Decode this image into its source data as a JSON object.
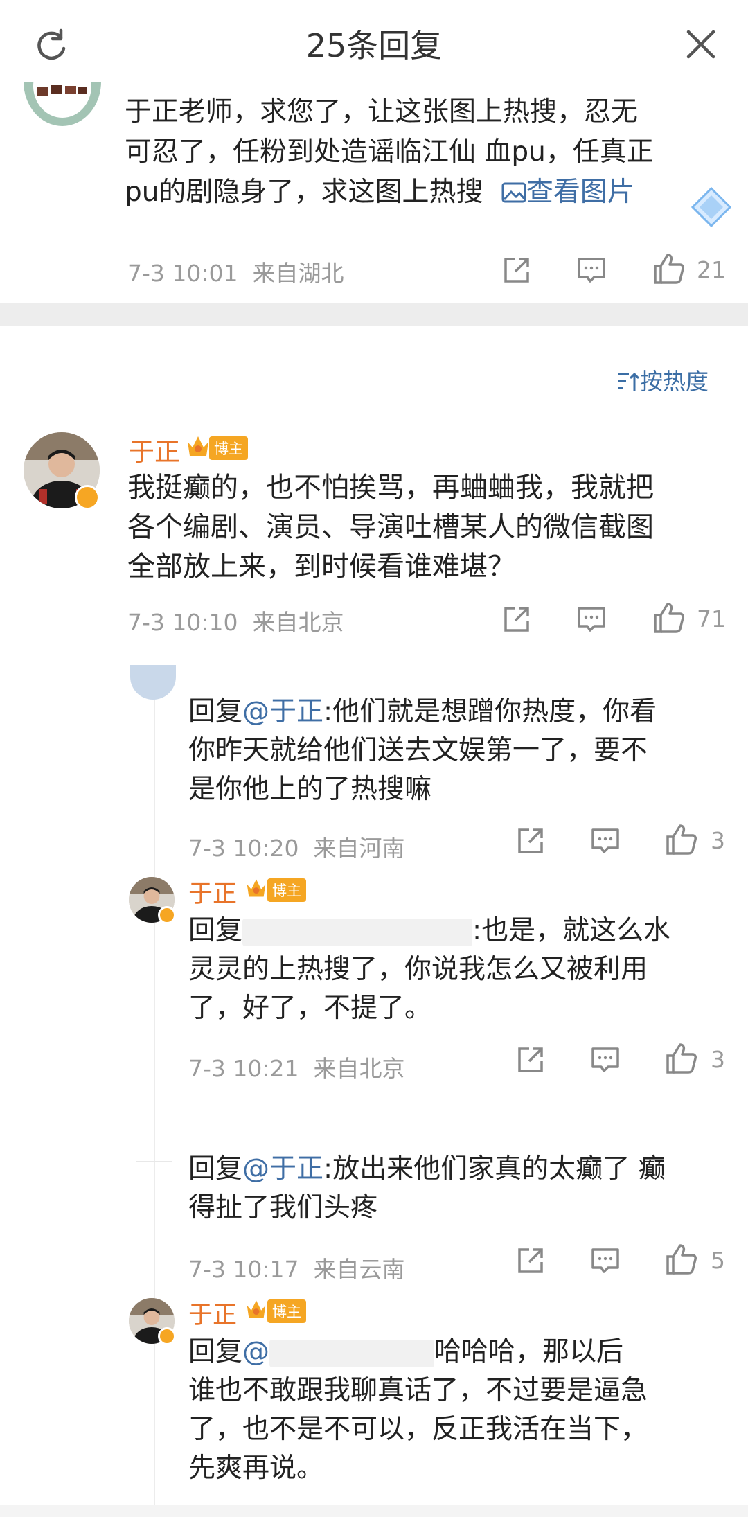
{
  "header": {
    "title": "25条回复"
  },
  "top_comment": {
    "lines": [
      "于正老师，求您了，让这张图上热搜，忍无",
      "可忍了，任粉到处造谣临江仙 血pu，任真正",
      "pu的剧隐身了，求这图上热搜"
    ],
    "view_image": "查看图片",
    "time": "7-3 10:01",
    "location": "来自湖北",
    "likes": "21"
  },
  "sort": {
    "label": "按热度"
  },
  "main_comment": {
    "author": "于正",
    "badge": "博主",
    "lines": [
      "我挺癫的，也不怕挨骂，再蛐蛐我，我就把",
      "各个编剧、演员、导演吐槽某人的微信截图",
      "全部放上来，到时候看谁难堪？"
    ],
    "time": "7-3 10:10",
    "location": "来自北京",
    "likes": "71"
  },
  "replies": [
    {
      "prefix": "回复",
      "mention": "@于正",
      "lines": [
        ":他们就是想蹭你热度，你看",
        "你昨天就给他们送去文娱第一了，要不",
        "是你他上的了热搜嘛"
      ],
      "time": "7-3 10:20",
      "location": "来自河南",
      "likes": "3"
    },
    {
      "author": "于正",
      "badge": "博主",
      "prefix": "回复",
      "lines": [
        ":也是，就这么水",
        "灵灵的上热搜了，你说我怎么又被利用",
        "了，好了，不提了。"
      ],
      "time": "7-3 10:21",
      "location": "来自北京",
      "likes": "3"
    },
    {
      "prefix": "回复",
      "mention": "@于正",
      "lines": [
        ":放出来他们家真的太癫了 癫",
        "得扯了我们头疼"
      ],
      "time": "7-3 10:17",
      "location": "来自云南",
      "likes": "5"
    },
    {
      "author": "于正",
      "badge": "博主",
      "prefix": "回复",
      "mention_partial": "@",
      "lines": [
        "哈哈哈，那以后",
        "谁也不敢跟我聊真话了，不过要是逼急",
        "了，也不是不可以，反正我活在当下，",
        "先爽再说。"
      ]
    }
  ],
  "colors": {
    "accent_link": "#3f6ea5",
    "username": "#e8742a",
    "badge": "#f5a623",
    "meta": "#9a9a9a"
  }
}
